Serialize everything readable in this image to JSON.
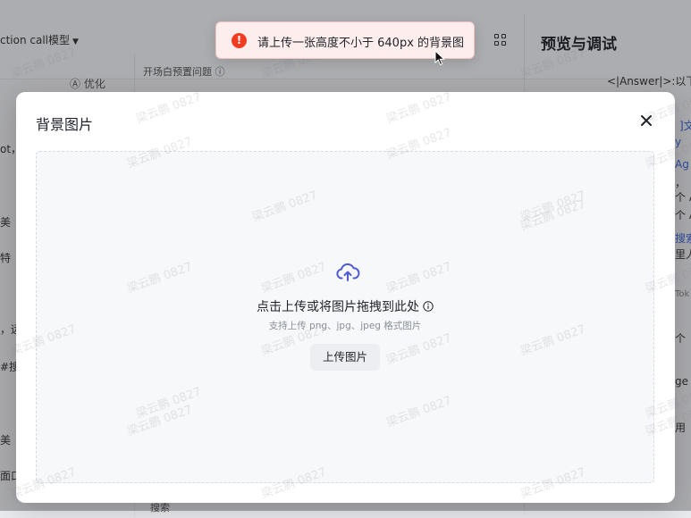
{
  "background": {
    "model_select": "ction call模型",
    "optimize_label": "优化",
    "prompt_label": "开场白预置问题",
    "preview_title": "预览与调试",
    "bottom_search": "搜索",
    "right_lines": [
      "<|Answer|>:以下",
      "]文",
      "y",
      "Ag",
      "，",
      "个 A",
      "个 A",
      "搜索",
      "里人",
      "Tok",
      "个 ",
      "ge",
      "用"
    ],
    "left_lines": [
      "ot，",
      "美",
      "特",
      "，远",
      "#搜",
      "美",
      "面口"
    ]
  },
  "watermark": {
    "text": "梁云鹏 0827"
  },
  "modal": {
    "title": "背景图片",
    "close_icon": "close-icon",
    "dropzone": {
      "icon": "cloud-upload-icon",
      "title": "点击上传或将图片拖拽到此处",
      "info_icon": "info-icon",
      "subtitle": "支持上传 png、jpg、jpeg 格式图片",
      "upload_button": "上传图片"
    }
  },
  "toast": {
    "type": "error",
    "icon": "error-icon",
    "icon_glyph": "!",
    "message": "请上传一张高度不小于 640px 的背景图",
    "color": "#f23c22"
  }
}
